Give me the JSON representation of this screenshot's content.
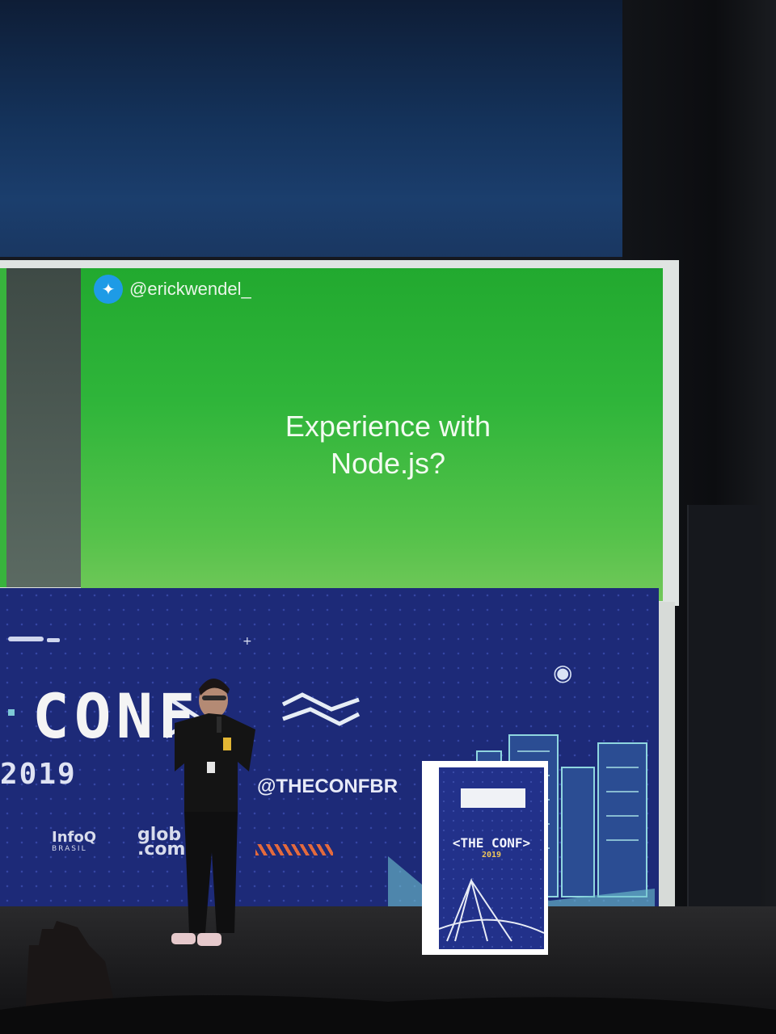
{
  "slide": {
    "twitter_handle": "@erickwendel_",
    "text_line1": "Experience with",
    "text_line2": "Node.js?"
  },
  "banner": {
    "conf_logo": "CONF",
    "year": "2019",
    "hashtag": "@THECONFBR",
    "sponsor_infoq": "InfoQ",
    "sponsor_infoq_sub": "BRASIL",
    "sponsor_globo": "glob\n.com"
  },
  "podium": {
    "logo": "<THE CONF>",
    "year": "2019"
  },
  "colors": {
    "slide_green": "#2fb53a",
    "banner_blue": "#1d2a78",
    "twitter_blue": "#1e9be6",
    "accent_orange": "#e46a3d"
  }
}
